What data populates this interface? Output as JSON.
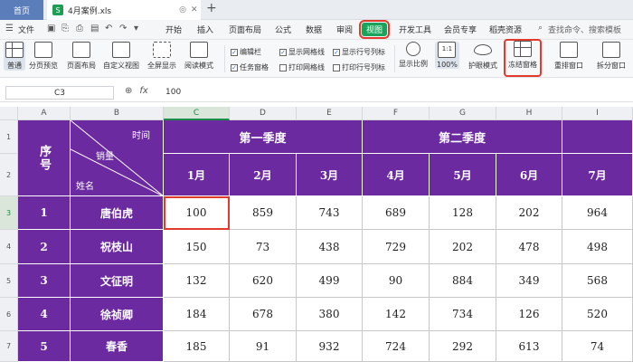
{
  "titlebar": {
    "home": "首页",
    "file_name": "4月案例.xls",
    "new_tab": "+"
  },
  "menubar": {
    "file": "文件",
    "items": [
      "开始",
      "插入",
      "页面布局",
      "公式",
      "数据",
      "审阅",
      "视图",
      "开发工具",
      "会员专享",
      "稻壳资源"
    ],
    "active": "视图",
    "search_placeholder": "查找命令、搜索模板"
  },
  "ribbon": {
    "normal": "普通",
    "page_break": "分页预览",
    "page_layout": "页面布局",
    "custom_view": "自定义视图",
    "fullscreen": "全屏显示",
    "reading_mode": "阅读模式",
    "checks": {
      "edit_bar": "编辑栏",
      "task_pane": "任务窗格",
      "show_grid": "显示网格线",
      "print_grid": "打印网格线",
      "show_headers": "显示行号列标",
      "print_headers": "打印行号列标"
    },
    "zoom": "显示比例",
    "zoom_100": "100%",
    "eye_mode": "护眼模式",
    "freeze": "冻结窗格",
    "rearrange": "重排窗口",
    "split": "拆分窗口"
  },
  "formula_bar": {
    "cell_ref": "C3",
    "value": "100"
  },
  "columns": [
    "A",
    "B",
    "C",
    "D",
    "E",
    "F",
    "G",
    "H",
    "I"
  ],
  "rows": [
    "1",
    "2",
    "3",
    "4",
    "5",
    "6",
    "7"
  ],
  "header": {
    "seq": "序号",
    "diag_time": "时间",
    "diag_sales": "销量",
    "diag_name": "姓名",
    "q1": "第一季度",
    "q2": "第二季度",
    "months": [
      "1月",
      "2月",
      "3月",
      "4月",
      "5月",
      "6月",
      "7月"
    ]
  },
  "table": [
    {
      "no": "1",
      "name": "唐伯虎",
      "values": [
        "100",
        "859",
        "743",
        "689",
        "128",
        "202",
        "964"
      ]
    },
    {
      "no": "2",
      "name": "祝枝山",
      "values": [
        "150",
        "73",
        "438",
        "729",
        "202",
        "478",
        "498"
      ]
    },
    {
      "no": "3",
      "name": "文征明",
      "values": [
        "132",
        "620",
        "499",
        "90",
        "884",
        "349",
        "568"
      ]
    },
    {
      "no": "4",
      "name": "徐祯卿",
      "values": [
        "184",
        "678",
        "380",
        "142",
        "734",
        "126",
        "520"
      ]
    },
    {
      "no": "5",
      "name": "春香",
      "values": [
        "185",
        "91",
        "932",
        "724",
        "292",
        "613",
        "74"
      ]
    }
  ],
  "colors": {
    "header_purple": "#6b2aa0",
    "active_green": "#1aa35a",
    "highlight_red": "#e03b2c"
  }
}
